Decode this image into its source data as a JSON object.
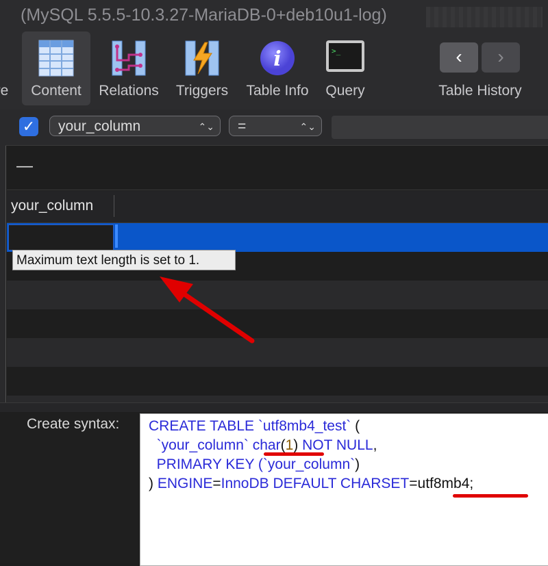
{
  "window": {
    "title": "(MySQL 5.5.5-10.3.27-MariaDB-0+deb10u1-log)"
  },
  "toolbar": {
    "structure_label_partial": "ure",
    "content_label": "Content",
    "relations_label": "Relations",
    "triggers_label": "Triggers",
    "tableinfo_label": "Table Info",
    "query_label": "Query",
    "history_label": "Table History",
    "back_glyph": "‹",
    "forward_glyph": "›"
  },
  "filter": {
    "enabled": true,
    "column": "your_column",
    "operator": "=",
    "value": "",
    "check_glyph": "✓",
    "select_arrows": "⌃⌄"
  },
  "table": {
    "dash": "—",
    "columns": [
      "your_column"
    ],
    "selected_row_value": ""
  },
  "tooltip": {
    "text": "Maximum text length is set to 1."
  },
  "syntax": {
    "label": "Create syntax:",
    "l1_a": "CREATE TABLE ",
    "l1_b": "`utf8mb4_test`",
    "l1_c": " (",
    "l2_a": "  `your_column` ",
    "l2_b": "char",
    "l2_c": "(",
    "l2_d": "1",
    "l2_e": ") ",
    "l2_f": "NOT NULL",
    "l2_g": ",",
    "l3_a": "  PRIMARY KEY (",
    "l3_b": "`your_column`",
    "l3_c": ")",
    "l4_a": ") ",
    "l4_b": "ENGINE",
    "l4_c": "=",
    "l4_d": "InnoDB DEFAULT CHARSET",
    "l4_e": "=",
    "l4_f": "utf8mb4;"
  },
  "colors": {
    "selection": "#0a56c9",
    "annotation": "#e00000",
    "sql_keyword": "#2a2ad8"
  }
}
